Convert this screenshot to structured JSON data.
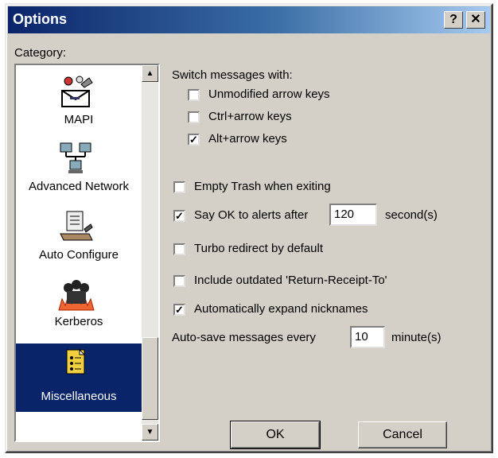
{
  "window": {
    "title": "Options",
    "help_glyph": "?",
    "close_glyph": "✕"
  },
  "category": {
    "label": "Category:",
    "items": [
      {
        "label": "MAPI",
        "icon": "mapi-icon"
      },
      {
        "label": "Advanced Network",
        "icon": "network-icon"
      },
      {
        "label": "Auto Configure",
        "icon": "auto-configure-icon"
      },
      {
        "label": "Kerberos",
        "icon": "kerberos-icon"
      },
      {
        "label": "Miscellaneous",
        "icon": "miscellaneous-icon",
        "selected": true
      }
    ],
    "scroll_up": "▲",
    "scroll_down": "▼"
  },
  "switch_messages": {
    "label": "Switch messages with:",
    "options": [
      {
        "label": "Unmodified arrow keys",
        "checked": false
      },
      {
        "label": "Ctrl+arrow keys",
        "checked": false
      },
      {
        "label": "Alt+arrow keys",
        "checked": true
      }
    ]
  },
  "settings": {
    "empty_trash": {
      "label": "Empty Trash when exiting",
      "checked": false
    },
    "say_ok": {
      "label": "Say OK to alerts after",
      "checked": true,
      "value": "120",
      "unit": "second(s)"
    },
    "turbo_redirect": {
      "label": "Turbo redirect by default",
      "checked": false
    },
    "include_outdated": {
      "label": "Include outdated 'Return-Receipt-To'",
      "checked": false
    },
    "auto_expand": {
      "label": "Automatically expand nicknames",
      "checked": true
    },
    "auto_save": {
      "label": "Auto-save messages every",
      "value": "10",
      "unit": "minute(s)"
    }
  },
  "buttons": {
    "ok": "OK",
    "cancel": "Cancel"
  },
  "check_glyph": "✓",
  "colors": {
    "title_bar": "#0a246a",
    "selection": "#0a246a",
    "face": "#d4d0c8"
  }
}
